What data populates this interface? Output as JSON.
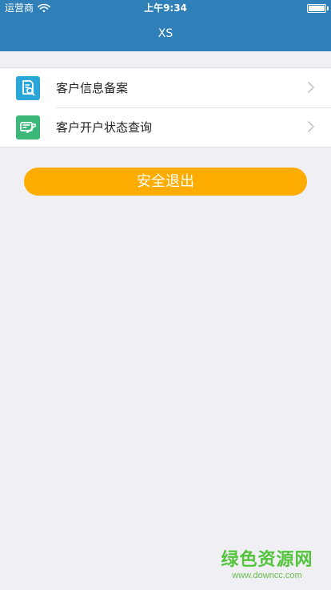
{
  "status_bar": {
    "carrier": "运营商",
    "time": "上午9:34",
    "wifi_icon": "wifi-icon",
    "battery_icon": "battery-full-icon"
  },
  "header": {
    "title": "XS",
    "background_color": "#2f7fb8"
  },
  "menu": {
    "items": [
      {
        "label": "客户信息备案",
        "icon": "customer-record-search-icon",
        "icon_color": "#2aa6d9"
      },
      {
        "label": "客户开户状态查询",
        "icon": "account-status-query-icon",
        "icon_color": "#3bb878"
      }
    ]
  },
  "actions": {
    "logout_label": "安全退出",
    "logout_color": "#ffac00"
  },
  "watermark": {
    "title": "绿色资源网",
    "url": "www.downcc.com"
  }
}
